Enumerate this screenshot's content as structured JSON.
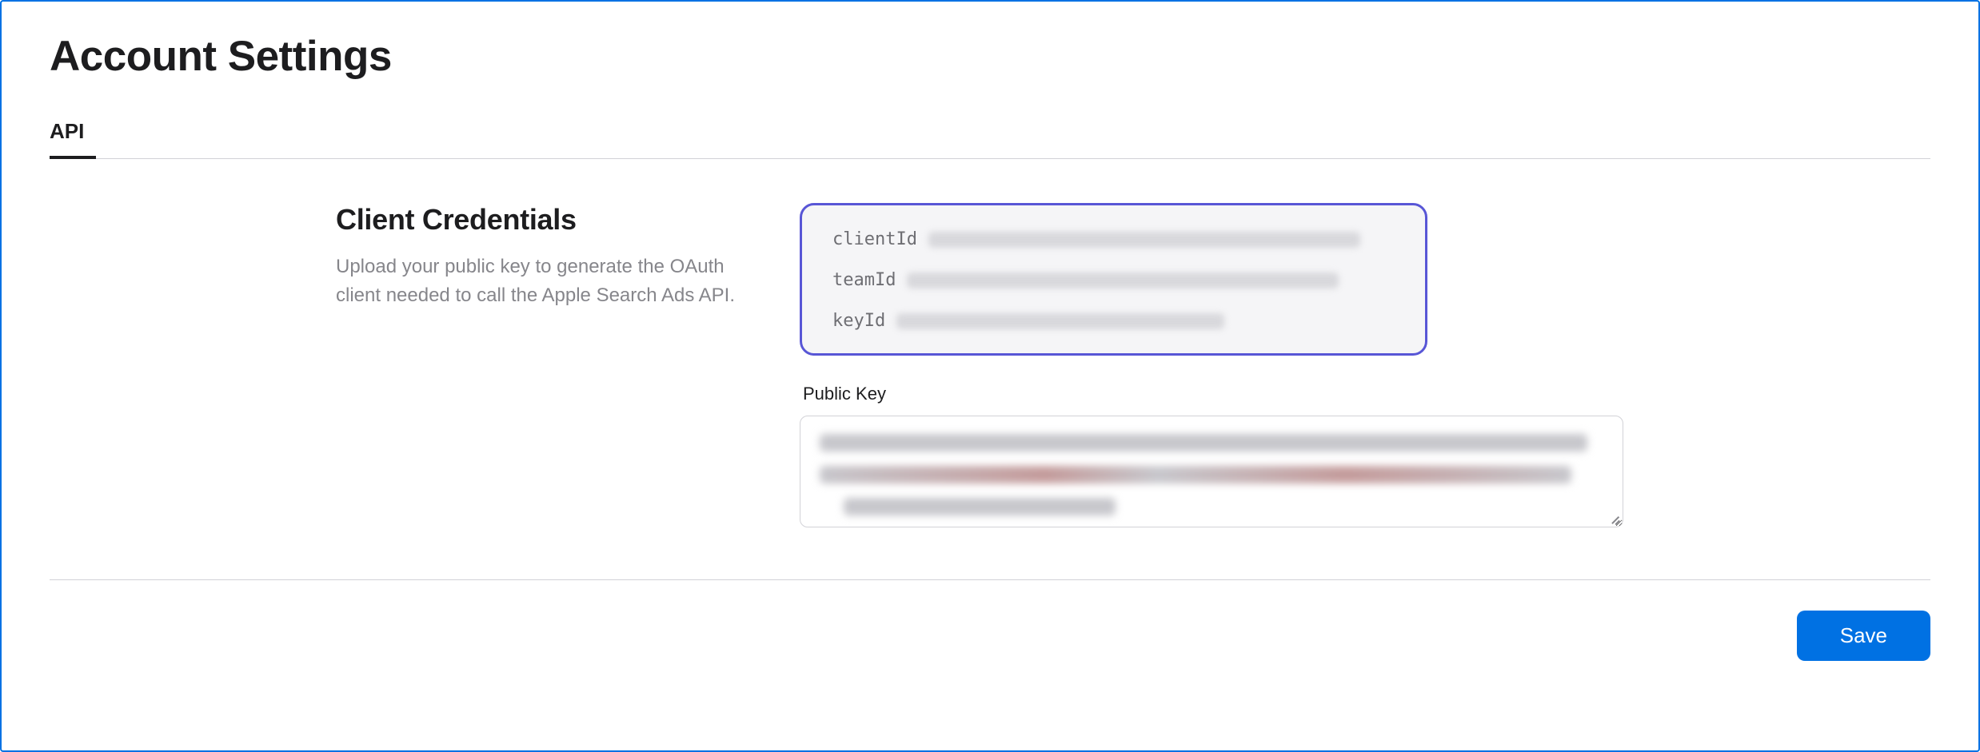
{
  "header": {
    "title": "Account Settings",
    "tabs": [
      {
        "label": "API",
        "active": true
      }
    ]
  },
  "section": {
    "heading": "Client Credentials",
    "description": "Upload your public key to generate the OAuth client needed to call the Apple Search Ads API."
  },
  "credentials": {
    "fields": [
      {
        "label": "clientId",
        "redacted": true,
        "width": "long"
      },
      {
        "label": "teamId",
        "redacted": true,
        "width": "long"
      },
      {
        "label": "keyId",
        "redacted": true,
        "width": "med"
      }
    ],
    "highlight_color": "#5856d6"
  },
  "public_key": {
    "label": "Public Key",
    "value_redacted": true
  },
  "actions": {
    "save_label": "Save"
  },
  "colors": {
    "accent": "#0071e3",
    "border_highlight": "#5856d6",
    "text_secondary": "#86868b"
  }
}
